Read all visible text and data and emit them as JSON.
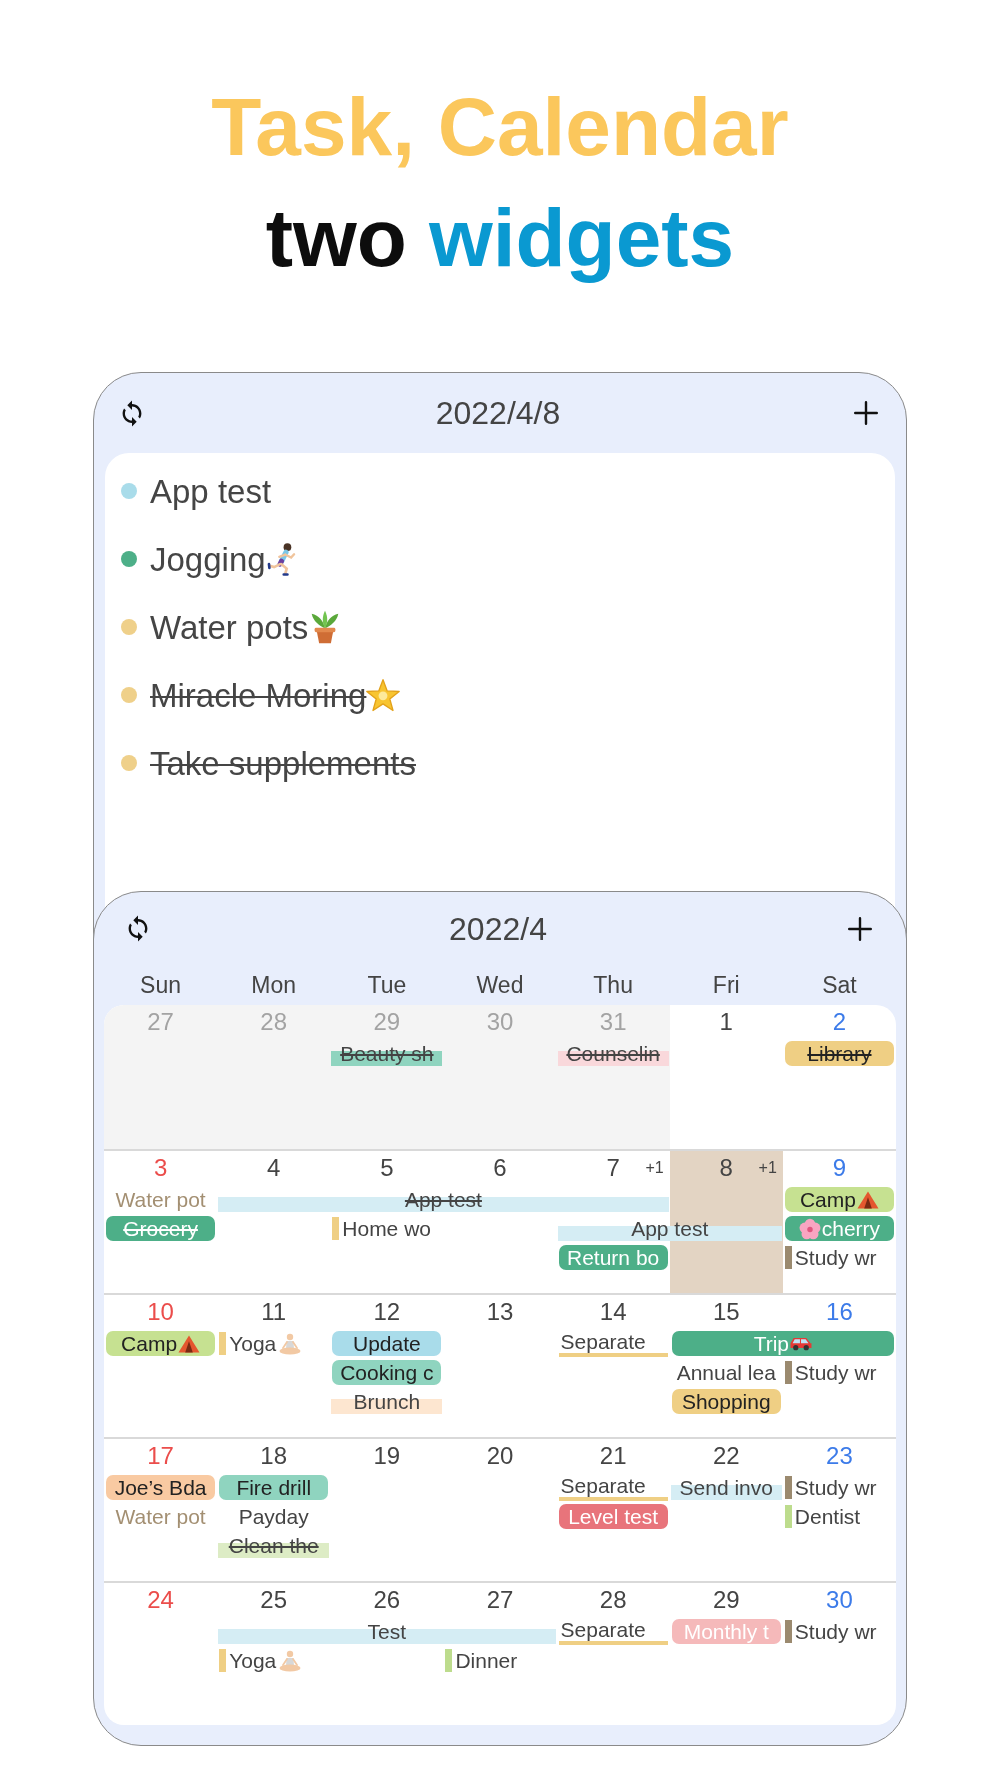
{
  "headline": {
    "lines": [
      [
        {
          "text": "Task, Calendar",
          "color": "#fbc75c"
        }
      ],
      [
        {
          "text": "two",
          "color": "#0d0d0d"
        },
        {
          "text": "widgets",
          "color": "#0a99d1"
        }
      ]
    ]
  },
  "task_widget": {
    "title": "2022/4/8",
    "tasks": [
      {
        "title": "App test",
        "color": "#a9dcea",
        "done": false
      },
      {
        "title": "Jogging",
        "color": "#4daf88",
        "done": false,
        "icon_after": true
      },
      {
        "title": "Water pots",
        "color": "#efd08a",
        "done": false,
        "icon_after": true
      },
      {
        "title": "Miracle Moring",
        "color": "#efd08a",
        "done": true,
        "icon_after": true
      },
      {
        "title": "Take supplements",
        "color": "#efd08a",
        "done": true
      }
    ]
  },
  "calendar_widget": {
    "title": "2022/4",
    "weekdays": [
      "Sun",
      "Mon",
      "Tue",
      "Wed",
      "Thu",
      "Fri",
      "Sat"
    ],
    "weeks": [
      {
        "days": [
          {
            "number": "27",
            "other_month": true,
            "today": false
          },
          {
            "number": "28",
            "other_month": true,
            "today": false
          },
          {
            "number": "29",
            "other_month": true,
            "today": false,
            "events": [
              {
                "title": "Beauty sh",
                "kind": "band",
                "color": "#8fd4bf",
                "done": true
              }
            ]
          },
          {
            "number": "30",
            "other_month": true,
            "today": false
          },
          {
            "number": "31",
            "other_month": true,
            "today": false,
            "events": [
              {
                "title": "Counselin",
                "kind": "band",
                "color": "#f9d8db",
                "done": true
              }
            ]
          },
          {
            "number": "1",
            "other_month": false,
            "today": false
          },
          {
            "number": "2",
            "other_month": false,
            "today": false,
            "events": [
              {
                "title": "Library",
                "kind": "fill",
                "color": "#efcf84",
                "done": true,
                "light_text": false
              }
            ]
          }
        ]
      },
      {
        "days": [
          {
            "number": "3",
            "other_month": false,
            "today": false,
            "events": [
              {
                "title": "Water pot",
                "kind": "plain",
                "color": "#a38f72",
                "done": false
              },
              {
                "title": "Grocery",
                "kind": "fill",
                "color": "#4daf88",
                "done": true,
                "light_text": true
              }
            ]
          },
          {
            "number": "4",
            "other_month": false,
            "today": false,
            "events": [
              {
                "title": "App test",
                "kind": "band",
                "color": "#d5edf4",
                "done": true,
                "multi_day": true
              }
            ]
          },
          {
            "number": "5",
            "other_month": false,
            "today": false,
            "events": [
              {
                "kind": "continued"
              },
              {
                "title": "Home wo",
                "kind": "bar",
                "color": "#efcf84",
                "done": false
              }
            ]
          },
          {
            "number": "6",
            "other_month": false,
            "today": false,
            "events": [
              {
                "kind": "continued"
              }
            ]
          },
          {
            "number": "7",
            "other_month": false,
            "today": false,
            "more": "+1",
            "events": [
              {
                "kind": "ends"
              },
              {
                "title": "App test",
                "kind": "band",
                "color": "#d5edf4",
                "done": false,
                "multi_day": true
              },
              {
                "title": "Return bo",
                "kind": "fill",
                "color": "#4daf88",
                "done": false,
                "light_text": true
              }
            ]
          },
          {
            "number": "8",
            "other_month": false,
            "today": true,
            "more": "+1",
            "events": [
              {
                "kind": "ends"
              }
            ]
          },
          {
            "number": "9",
            "other_month": false,
            "today": false,
            "events": [
              {
                "title": "Camp",
                "kind": "fill",
                "color": "#c6e191",
                "done": false,
                "light_text": false,
                "icon_after": true
              },
              {
                "title": "cherry",
                "kind": "fill",
                "color": "#4daf88",
                "done": false,
                "light_text": true,
                "icon_before": true
              },
              {
                "title": "Study wr",
                "kind": "bar",
                "color": "#9b8a6f",
                "done": false
              }
            ]
          }
        ]
      },
      {
        "days": [
          {
            "number": "10",
            "other_month": false,
            "today": false,
            "events": [
              {
                "title": "Camp",
                "kind": "fill",
                "color": "#c6e191",
                "done": false,
                "light_text": false,
                "icon_after": true
              }
            ]
          },
          {
            "number": "11",
            "other_month": false,
            "today": false,
            "events": [
              {
                "title": "Yoga",
                "kind": "bar",
                "color": "#efcf84",
                "done": false,
                "icon_after": true
              }
            ]
          },
          {
            "number": "12",
            "other_month": false,
            "today": false,
            "events": [
              {
                "title": "Update",
                "kind": "fill",
                "color": "#a9dcea",
                "done": false,
                "light_text": false
              },
              {
                "title": "Cooking c",
                "kind": "fill",
                "color": "#8fd4bf",
                "done": false,
                "light_text": false
              },
              {
                "title": "Brunch",
                "kind": "band",
                "color": "#fde6d0",
                "done": false
              }
            ]
          },
          {
            "number": "13",
            "other_month": false,
            "today": false
          },
          {
            "number": "14",
            "other_month": false,
            "today": false,
            "events": [
              {
                "title": "Separate",
                "kind": "underline",
                "color": "#efcf84",
                "done": false
              }
            ]
          },
          {
            "number": "15",
            "other_month": false,
            "today": false,
            "events": [
              {
                "title": "Trip",
                "kind": "fill",
                "color": "#4daf88",
                "done": false,
                "light_text": true,
                "multi_day": true,
                "icon_after": true
              },
              {
                "title": "Annual lea",
                "kind": "plain",
                "color": "#444444",
                "done": false
              },
              {
                "title": "Shopping",
                "kind": "fill",
                "color": "#efcf84",
                "done": false,
                "light_text": false
              }
            ]
          },
          {
            "number": "16",
            "other_month": false,
            "today": false,
            "events": [
              {
                "kind": "ends"
              },
              {
                "title": "Study wr",
                "kind": "bar",
                "color": "#9b8a6f",
                "done": false
              }
            ]
          }
        ]
      },
      {
        "days": [
          {
            "number": "17",
            "other_month": false,
            "today": false,
            "events": [
              {
                "title": "Joe’s Bda",
                "kind": "fill",
                "color": "#f9caa2",
                "done": false,
                "light_text": false
              },
              {
                "title": "Water pot",
                "kind": "plain",
                "color": "#a38f72",
                "done": false
              }
            ]
          },
          {
            "number": "18",
            "other_month": false,
            "today": false,
            "events": [
              {
                "title": "Fire drill",
                "kind": "fill",
                "color": "#8fd4bf",
                "done": false,
                "light_text": false
              },
              {
                "title": "Payday",
                "kind": "plain",
                "color": "#444444",
                "done": false
              },
              {
                "title": "Clean the",
                "kind": "band",
                "color": "#ddecc5",
                "done": true
              }
            ]
          },
          {
            "number": "19",
            "other_month": false,
            "today": false
          },
          {
            "number": "20",
            "other_month": false,
            "today": false
          },
          {
            "number": "21",
            "other_month": false,
            "today": false,
            "events": [
              {
                "title": "Separate",
                "kind": "underline",
                "color": "#efcf84",
                "done": false
              },
              {
                "title": "Level test",
                "kind": "fill",
                "color": "#e8747b",
                "done": false,
                "light_text": true
              }
            ]
          },
          {
            "number": "22",
            "other_month": false,
            "today": false,
            "events": [
              {
                "title": "Send invo",
                "kind": "band",
                "color": "#d5edf4",
                "done": false
              }
            ]
          },
          {
            "number": "23",
            "other_month": false,
            "today": false,
            "events": [
              {
                "title": "Study wr",
                "kind": "bar",
                "color": "#9b8a6f",
                "done": false
              },
              {
                "title": "Dentist",
                "kind": "bar",
                "color": "#bddc8d",
                "done": false
              }
            ]
          }
        ]
      },
      {
        "days": [
          {
            "number": "24",
            "other_month": false,
            "today": false
          },
          {
            "number": "25",
            "other_month": false,
            "today": false,
            "events": [
              {
                "title": "Test",
                "kind": "band",
                "color": "#d5edf4",
                "done": false,
                "multi_day": true
              },
              {
                "title": "Yoga",
                "kind": "bar",
                "color": "#efcf84",
                "done": false,
                "icon_after": true
              }
            ]
          },
          {
            "number": "26",
            "other_month": false,
            "today": false,
            "events": [
              {
                "kind": "continued"
              }
            ]
          },
          {
            "number": "27",
            "other_month": false,
            "today": false,
            "events": [
              {
                "kind": "ends"
              },
              {
                "title": "Dinner",
                "kind": "bar",
                "color": "#bddc8d",
                "done": false
              }
            ]
          },
          {
            "number": "28",
            "other_month": false,
            "today": false,
            "events": [
              {
                "title": "Separate",
                "kind": "underline",
                "color": "#efcf84",
                "done": false
              }
            ]
          },
          {
            "number": "29",
            "other_month": false,
            "today": false,
            "events": [
              {
                "title": "Monthly t",
                "kind": "fill",
                "color": "#f5b9ba",
                "done": false,
                "light_text": true
              }
            ]
          },
          {
            "number": "30",
            "other_month": false,
            "today": false,
            "events": [
              {
                "title": "Study wr",
                "kind": "bar",
                "color": "#9b8a6f",
                "done": false
              }
            ]
          }
        ]
      }
    ]
  }
}
